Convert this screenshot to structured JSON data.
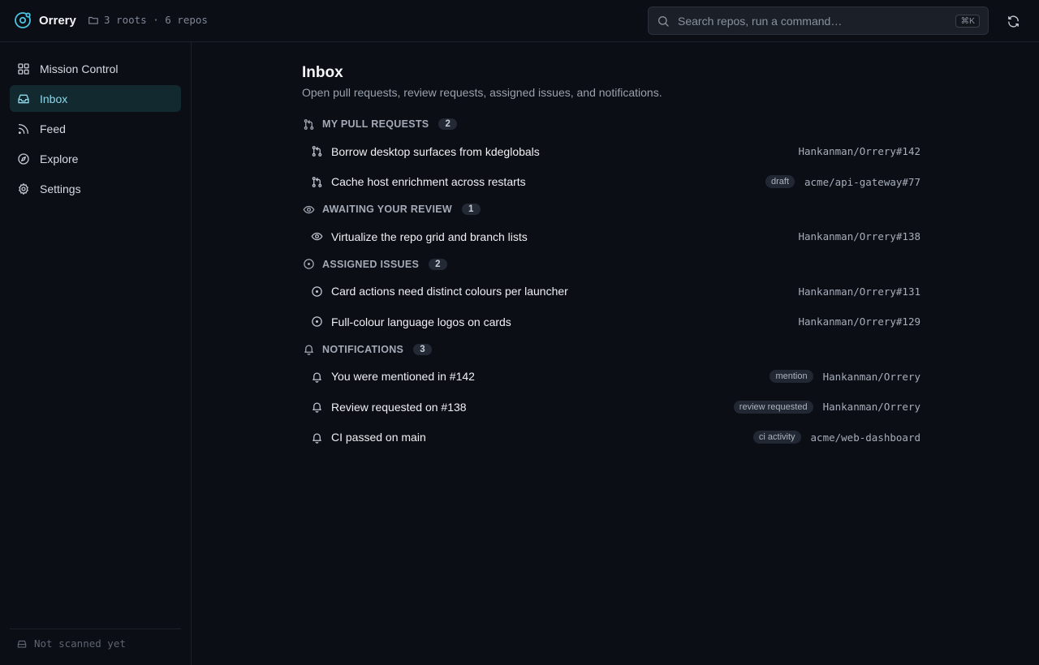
{
  "app": {
    "name": "Orrery"
  },
  "workspace": {
    "summary": "3 roots · 6 repos"
  },
  "search": {
    "placeholder": "Search repos, run a command…",
    "shortcut": "⌘K"
  },
  "sidebar": {
    "items": [
      {
        "label": "Mission Control",
        "icon": "grid-icon",
        "active": false
      },
      {
        "label": "Inbox",
        "icon": "inbox-icon",
        "active": true
      },
      {
        "label": "Feed",
        "icon": "rss-icon",
        "active": false
      },
      {
        "label": "Explore",
        "icon": "compass-icon",
        "active": false
      },
      {
        "label": "Settings",
        "icon": "gear-icon",
        "active": false
      }
    ],
    "footer": "Not scanned yet"
  },
  "page": {
    "title": "Inbox",
    "subtitle": "Open pull requests, review requests, assigned issues, and notifications."
  },
  "sections": [
    {
      "title": "MY PULL REQUESTS",
      "count": "2",
      "icon": "pull-request-icon",
      "items": [
        {
          "title": "Borrow desktop surfaces from kdeglobals",
          "tag": "",
          "ref": "Hankanman/Orrery#142"
        },
        {
          "title": "Cache host enrichment across restarts",
          "tag": "draft",
          "ref": "acme/api-gateway#77"
        }
      ]
    },
    {
      "title": "AWAITING YOUR REVIEW",
      "count": "1",
      "icon": "eye-icon",
      "items": [
        {
          "title": "Virtualize the repo grid and branch lists",
          "tag": "",
          "ref": "Hankanman/Orrery#138"
        }
      ]
    },
    {
      "title": "ASSIGNED ISSUES",
      "count": "2",
      "icon": "issue-icon",
      "items": [
        {
          "title": "Card actions need distinct colours per launcher",
          "tag": "",
          "ref": "Hankanman/Orrery#131"
        },
        {
          "title": "Full-colour language logos on cards",
          "tag": "",
          "ref": "Hankanman/Orrery#129"
        }
      ]
    },
    {
      "title": "NOTIFICATIONS",
      "count": "3",
      "icon": "bell-icon",
      "items": [
        {
          "title": "You were mentioned in #142",
          "tag": "mention",
          "ref": "Hankanman/Orrery"
        },
        {
          "title": "Review requested on #138",
          "tag": "review requested",
          "ref": "Hankanman/Orrery"
        },
        {
          "title": "CI passed on main",
          "tag": "ci activity",
          "ref": "acme/web-dashboard"
        }
      ]
    }
  ],
  "colors": {
    "accent": "#4cc3e0",
    "background": "#0b0e14",
    "active_nav_bg": "#11292f"
  }
}
